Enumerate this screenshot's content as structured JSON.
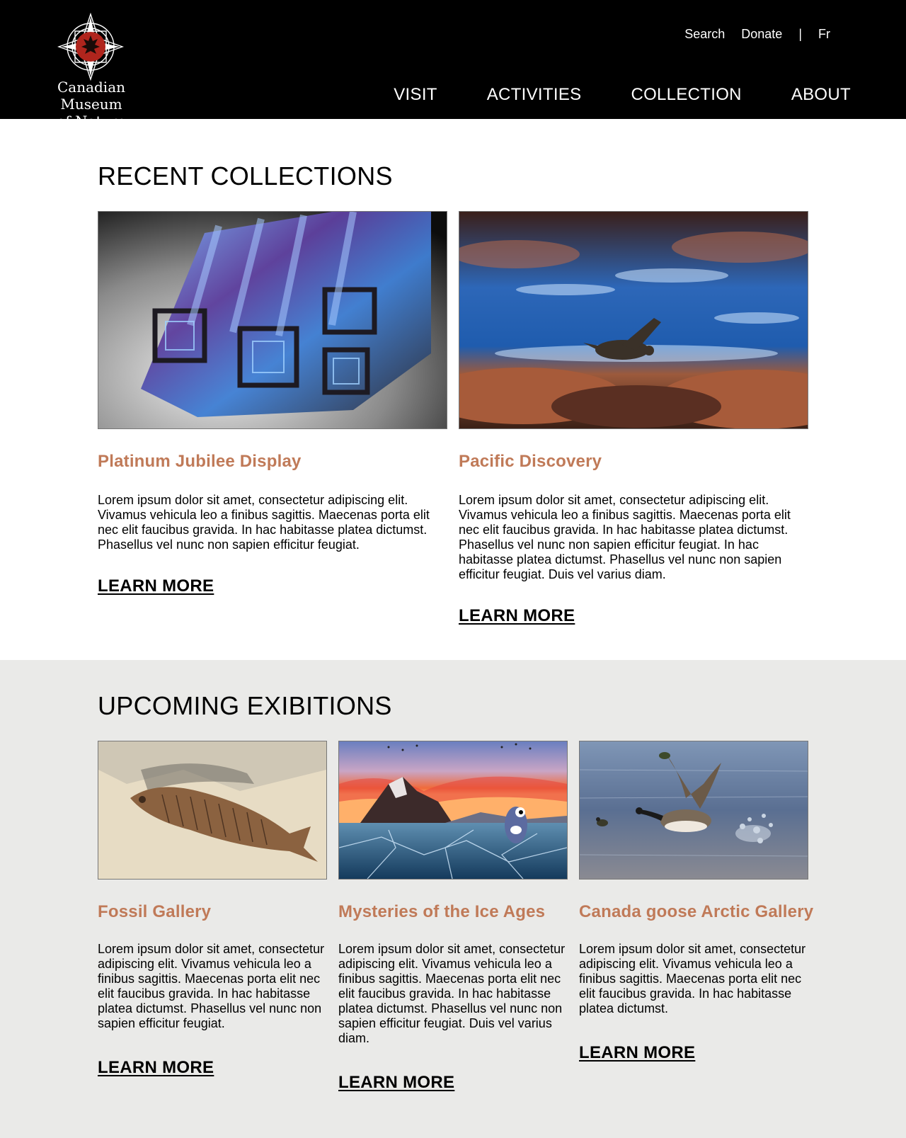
{
  "brand": {
    "name_line1": "Canadian Museum",
    "name_line2": "of Nature"
  },
  "utility_nav": {
    "search": "Search",
    "donate": "Donate",
    "separator": "|",
    "language": "Fr"
  },
  "main_nav": {
    "visit": "VISIT",
    "activities": "ACTIVITIES",
    "collection": "COLLECTION",
    "about": "ABOUT"
  },
  "recent": {
    "title": "RECENT COLLECTIONS",
    "cards": [
      {
        "title": "Platinum Jubilee Display",
        "text": "Lorem ipsum dolor sit amet, consectetur adipiscing elit. Vivamus vehicula leo a finibus sagittis. Maecenas porta elit nec elit faucibus gravida. In hac habitasse platea dictumst. Phasellus vel nunc non sapien efficitur feugiat.",
        "link": "LEARN MORE",
        "image": "bismuth-crystal"
      },
      {
        "title": "Pacific Discovery",
        "text": "Lorem ipsum dolor sit amet, consectetur adipiscing elit. Vivamus vehicula leo a finibus sagittis. Maecenas porta elit nec elit faucibus gravida. In hac habitasse platea dictumst. Phasellus vel nunc non sapien efficitur feugiat. In hac habitasse platea dictumst. Phasellus vel nunc non sapien efficitur feugiat. Duis vel varius diam.",
        "link": "LEARN MORE",
        "image": "sea-turtle-underwater"
      }
    ]
  },
  "upcoming": {
    "title": "UPCOMING EXIBITIONS",
    "cards": [
      {
        "title": "Fossil Gallery",
        "text": "Lorem ipsum dolor sit amet, consectetur adipiscing elit. Vivamus vehicula leo a finibus sagittis. Maecenas porta elit nec elit faucibus gravida. In hac habitasse platea dictumst. Phasellus vel nunc non sapien efficitur feugiat.",
        "link": "LEARN MORE",
        "image": "fish-fossil"
      },
      {
        "title": "Mysteries of the Ice Ages",
        "text": "Lorem ipsum dolor sit amet, consectetur adipiscing elit. Vivamus vehicula leo a finibus sagittis. Maecenas porta elit nec elit faucibus gravida. In hac habitasse platea dictumst. Phasellus vel nunc non sapien efficitur feugiat. Duis vel varius diam.",
        "link": "LEARN MORE",
        "image": "ice-age-scene"
      },
      {
        "title": "Canada goose Arctic Gallery",
        "text": "Lorem ipsum dolor sit amet, consectetur adipiscing elit. Vivamus vehicula leo a finibus sagittis. Maecenas porta elit nec elit faucibus gravida. In hac habitasse platea dictumst.",
        "link": "LEARN MORE",
        "image": "canada-goose-water"
      }
    ]
  },
  "colors": {
    "header_bg": "#000000",
    "accent": "#c07a58",
    "band_bg": "#eaeae8"
  }
}
